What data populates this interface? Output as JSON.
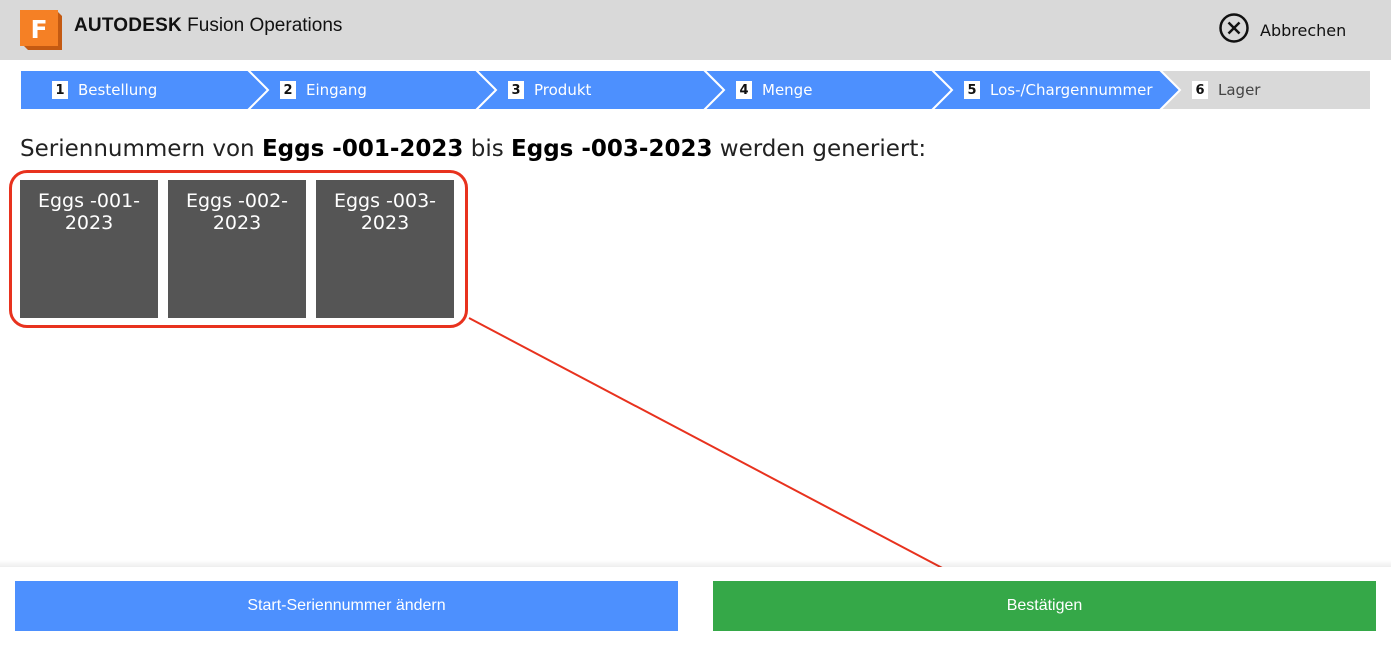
{
  "header": {
    "logo_letter": "F",
    "brand": "AUTODESK",
    "product": "Fusion Operations",
    "cancel_label": "Abbrechen"
  },
  "steps": [
    {
      "num": "1",
      "label": "Bestellung",
      "state": "done"
    },
    {
      "num": "2",
      "label": "Eingang",
      "state": "done"
    },
    {
      "num": "3",
      "label": "Produkt",
      "state": "done"
    },
    {
      "num": "4",
      "label": "Menge",
      "state": "done"
    },
    {
      "num": "5",
      "label": "Los-/Chargennummer",
      "state": "current"
    },
    {
      "num": "6",
      "label": "Lager",
      "state": "pending"
    }
  ],
  "main": {
    "headline_prefix": "Seriennummern von",
    "range_start": "Eggs -001-2023",
    "headline_mid": "bis",
    "range_end": "Eggs -003-2023",
    "headline_suffix": "werden generiert:",
    "serials": [
      "Eggs -001-2023",
      "Eggs -002-2023",
      "Eggs -003-2023"
    ]
  },
  "footer": {
    "change_start_label": "Start-Seriennummer ändern",
    "confirm_label": "Bestätigen"
  },
  "colors": {
    "step_active": "#4d90fe",
    "step_pending": "#d9d9d9",
    "tile": "#555555",
    "confirm": "#35a848",
    "annotation": "#e8321e"
  }
}
